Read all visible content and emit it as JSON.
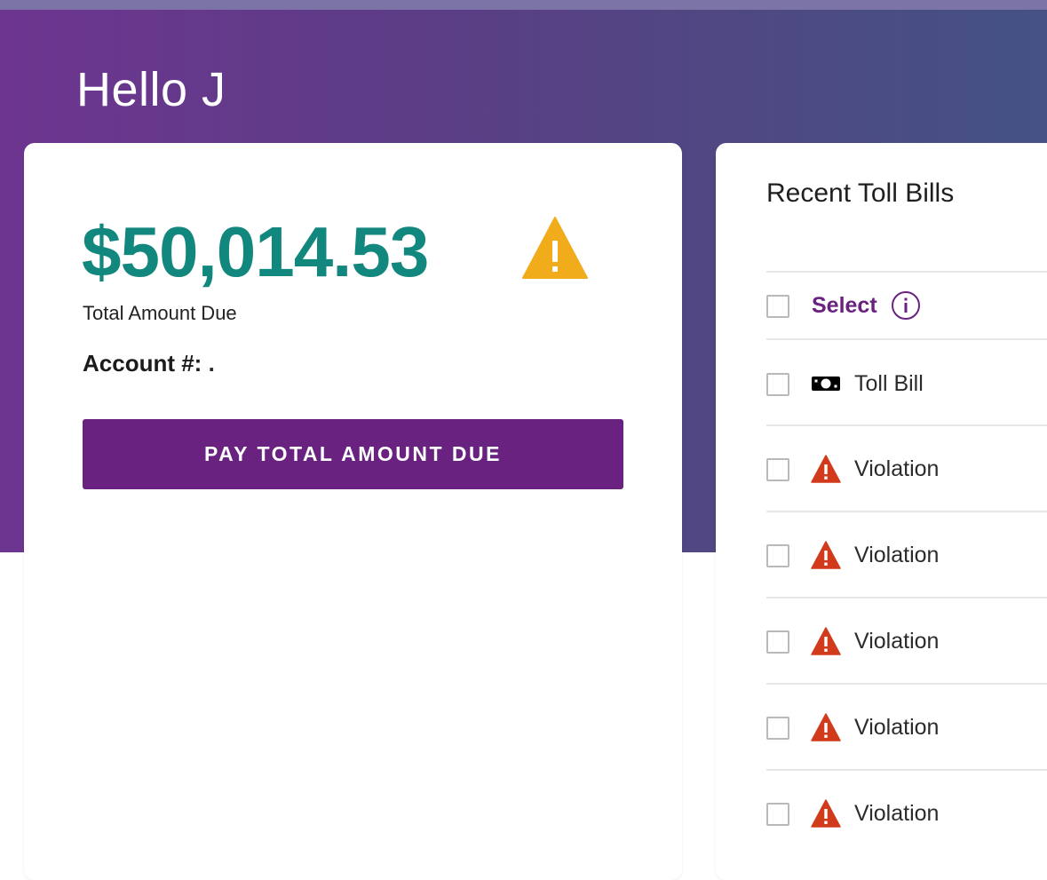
{
  "header": {
    "greeting": "Hello J"
  },
  "summary": {
    "amount": "$50,014.53",
    "amount_label": "Total Amount Due",
    "account_label": "Account #:",
    "account_value": ".",
    "pay_button_label": "PAY TOTAL AMOUNT DUE"
  },
  "recent_bills": {
    "title": "Recent Toll Bills",
    "select_label": "Select",
    "rows": [
      {
        "type": "toll-bill",
        "label": "Toll Bill",
        "icon": "cash-icon"
      },
      {
        "type": "violation",
        "label": "Violation",
        "icon": "warning-icon"
      },
      {
        "type": "violation",
        "label": "Violation",
        "icon": "warning-icon"
      },
      {
        "type": "violation",
        "label": "Violation",
        "icon": "warning-icon"
      },
      {
        "type": "violation",
        "label": "Violation",
        "icon": "warning-icon"
      },
      {
        "type": "violation",
        "label": "Violation",
        "icon": "warning-icon"
      }
    ]
  },
  "colors": {
    "brand_purple": "#6a2280",
    "amount_teal": "#12877e",
    "warning_amber": "#f0ac1b",
    "violation_red": "#d23a1c"
  }
}
